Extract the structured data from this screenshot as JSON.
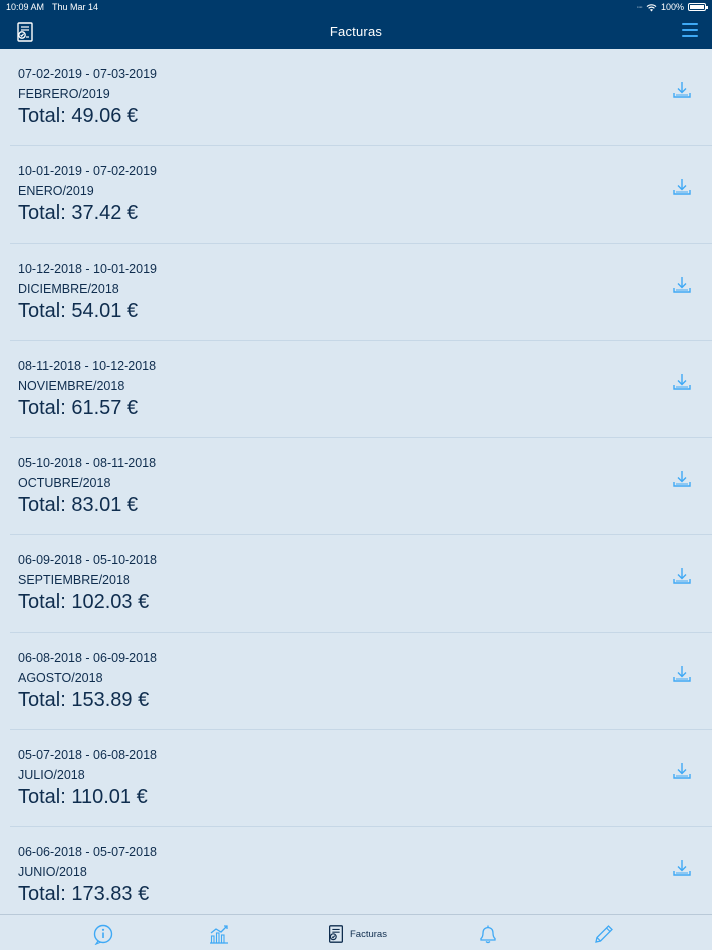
{
  "status": {
    "time": "10:09 AM",
    "date": "Thu Mar 14",
    "battery": "100%",
    "battery_level": 1.0
  },
  "nav": {
    "title": "Facturas"
  },
  "invoices": [
    {
      "dates": "07-02-2019 - 07-03-2019",
      "period": "FEBRERO/2019",
      "total": "Total: 49.06 €"
    },
    {
      "dates": "10-01-2019 - 07-02-2019",
      "period": "ENERO/2019",
      "total": "Total: 37.42 €"
    },
    {
      "dates": "10-12-2018 - 10-01-2019",
      "period": "DICIEMBRE/2018",
      "total": "Total: 54.01 €"
    },
    {
      "dates": "08-11-2018 - 10-12-2018",
      "period": "NOVIEMBRE/2018",
      "total": "Total: 61.57 €"
    },
    {
      "dates": "05-10-2018 - 08-11-2018",
      "period": "OCTUBRE/2018",
      "total": "Total: 83.01 €"
    },
    {
      "dates": "06-09-2018 - 05-10-2018",
      "period": "SEPTIEMBRE/2018",
      "total": "Total: 102.03 €"
    },
    {
      "dates": "06-08-2018 - 06-09-2018",
      "period": "AGOSTO/2018",
      "total": "Total: 153.89 €"
    },
    {
      "dates": "05-07-2018 - 06-08-2018",
      "period": "JULIO/2018",
      "total": "Total: 110.01 €"
    },
    {
      "dates": "06-06-2018 - 05-07-2018",
      "period": "JUNIO/2018",
      "total": "Total: 173.83 €"
    }
  ],
  "tabs": [
    {
      "icon": "info-icon",
      "label": ""
    },
    {
      "icon": "chart-icon",
      "label": ""
    },
    {
      "icon": "invoice-icon",
      "label": "Facturas"
    },
    {
      "icon": "bell-icon",
      "label": ""
    },
    {
      "icon": "pencil-icon",
      "label": ""
    }
  ],
  "colors": {
    "nav_bg": "#003a6b",
    "accent": "#3fa9f5",
    "text": "#0f2d4e",
    "background": "#dbe7f1"
  }
}
